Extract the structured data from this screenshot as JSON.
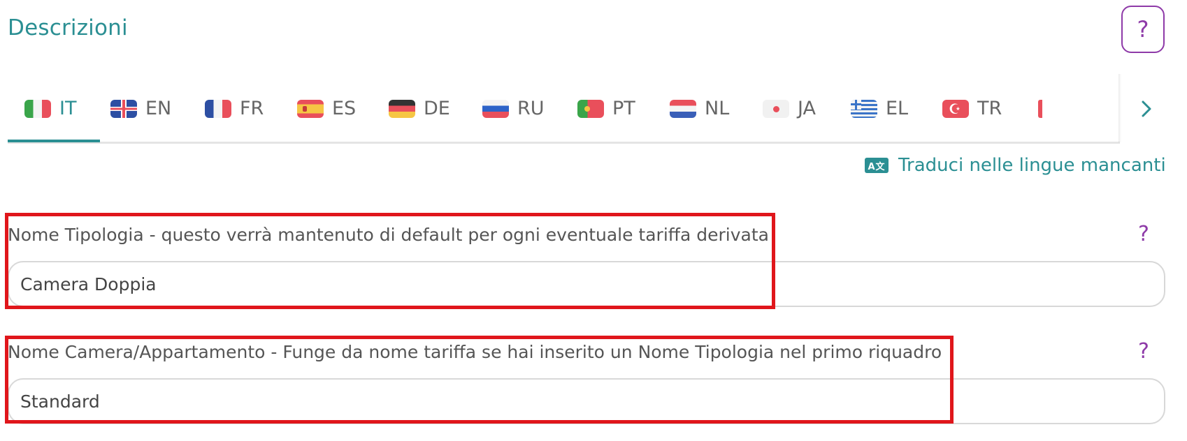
{
  "section": {
    "title": "Descrizioni",
    "help": "?"
  },
  "tabs": [
    {
      "code": "IT",
      "flag": "it",
      "active": true
    },
    {
      "code": "EN",
      "flag": "uk"
    },
    {
      "code": "FR",
      "flag": "fr"
    },
    {
      "code": "ES",
      "flag": "es"
    },
    {
      "code": "DE",
      "flag": "de"
    },
    {
      "code": "RU",
      "flag": "ru"
    },
    {
      "code": "PT",
      "flag": "pt"
    },
    {
      "code": "NL",
      "flag": "nl"
    },
    {
      "code": "JA",
      "flag": "ja"
    },
    {
      "code": "EL",
      "flag": "el"
    },
    {
      "code": "TR",
      "flag": "tr"
    }
  ],
  "translate": {
    "label": "Traduci nelle lingue mancanti",
    "icon": "translate-icon"
  },
  "fields": {
    "nome_tipologia": {
      "label": "Nome Tipologia - questo verrà mantenuto di default per ogni eventuale tariffa derivata",
      "value": "Camera Doppia",
      "help": "?"
    },
    "nome_camera": {
      "label": "Nome Camera/Appartamento - Funge da nome tariffa se hai inserito un Nome Tipologia nel primo riquadro",
      "value": "Standard",
      "help": "?"
    }
  },
  "colors": {
    "accent": "#2b8f93",
    "help": "#8e3aa8",
    "highlight": "#e0161b"
  }
}
